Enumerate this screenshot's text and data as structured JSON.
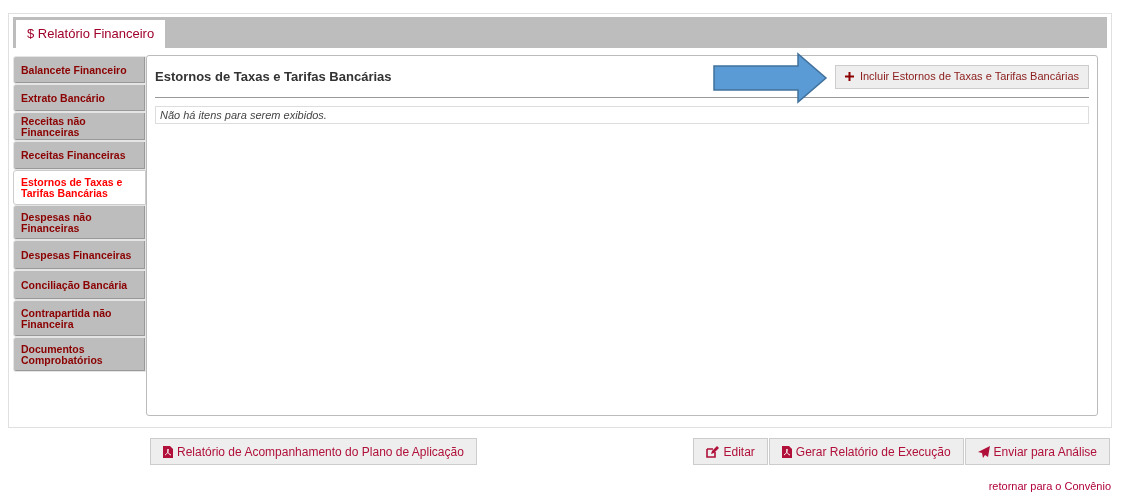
{
  "tabs": [
    {
      "label": "$ Relatório Financeiro",
      "selected": true
    }
  ],
  "sidebar": {
    "items": [
      {
        "label": "Balancete Financeiro",
        "selected": false
      },
      {
        "label": "Extrato Bancário",
        "selected": false
      },
      {
        "label": "Receitas não Financeiras",
        "selected": false
      },
      {
        "label": "Receitas Financeiras",
        "selected": false
      },
      {
        "label": "Estornos de Taxas e Tarifas Bancárias",
        "selected": true
      },
      {
        "label": "Despesas não Financeiras",
        "selected": false
      },
      {
        "label": "Despesas Financeiras",
        "selected": false
      },
      {
        "label": "Conciliação Bancária",
        "selected": false
      },
      {
        "label": "Contrapartida não Financeira",
        "selected": false
      },
      {
        "label": "Documentos Comprobatórios",
        "selected": false
      }
    ]
  },
  "content": {
    "title": "Estornos de Taxas e Tarifas Bancárias",
    "add_button": "Incluir Estornos de Taxas e Tarifas Bancárias",
    "empty_message": "Não há itens para serem exibidos."
  },
  "footer_buttons": [
    {
      "label": "Relatório de Acompanhamento do Plano de Aplicação",
      "kind": "pdf"
    },
    {
      "label": "Editar",
      "kind": "edit"
    },
    {
      "label": "Gerar Relatório de Execução",
      "kind": "pdf"
    },
    {
      "label": "Enviar para Análise",
      "kind": "send"
    }
  ],
  "return_link": "retornar para o Convênio"
}
